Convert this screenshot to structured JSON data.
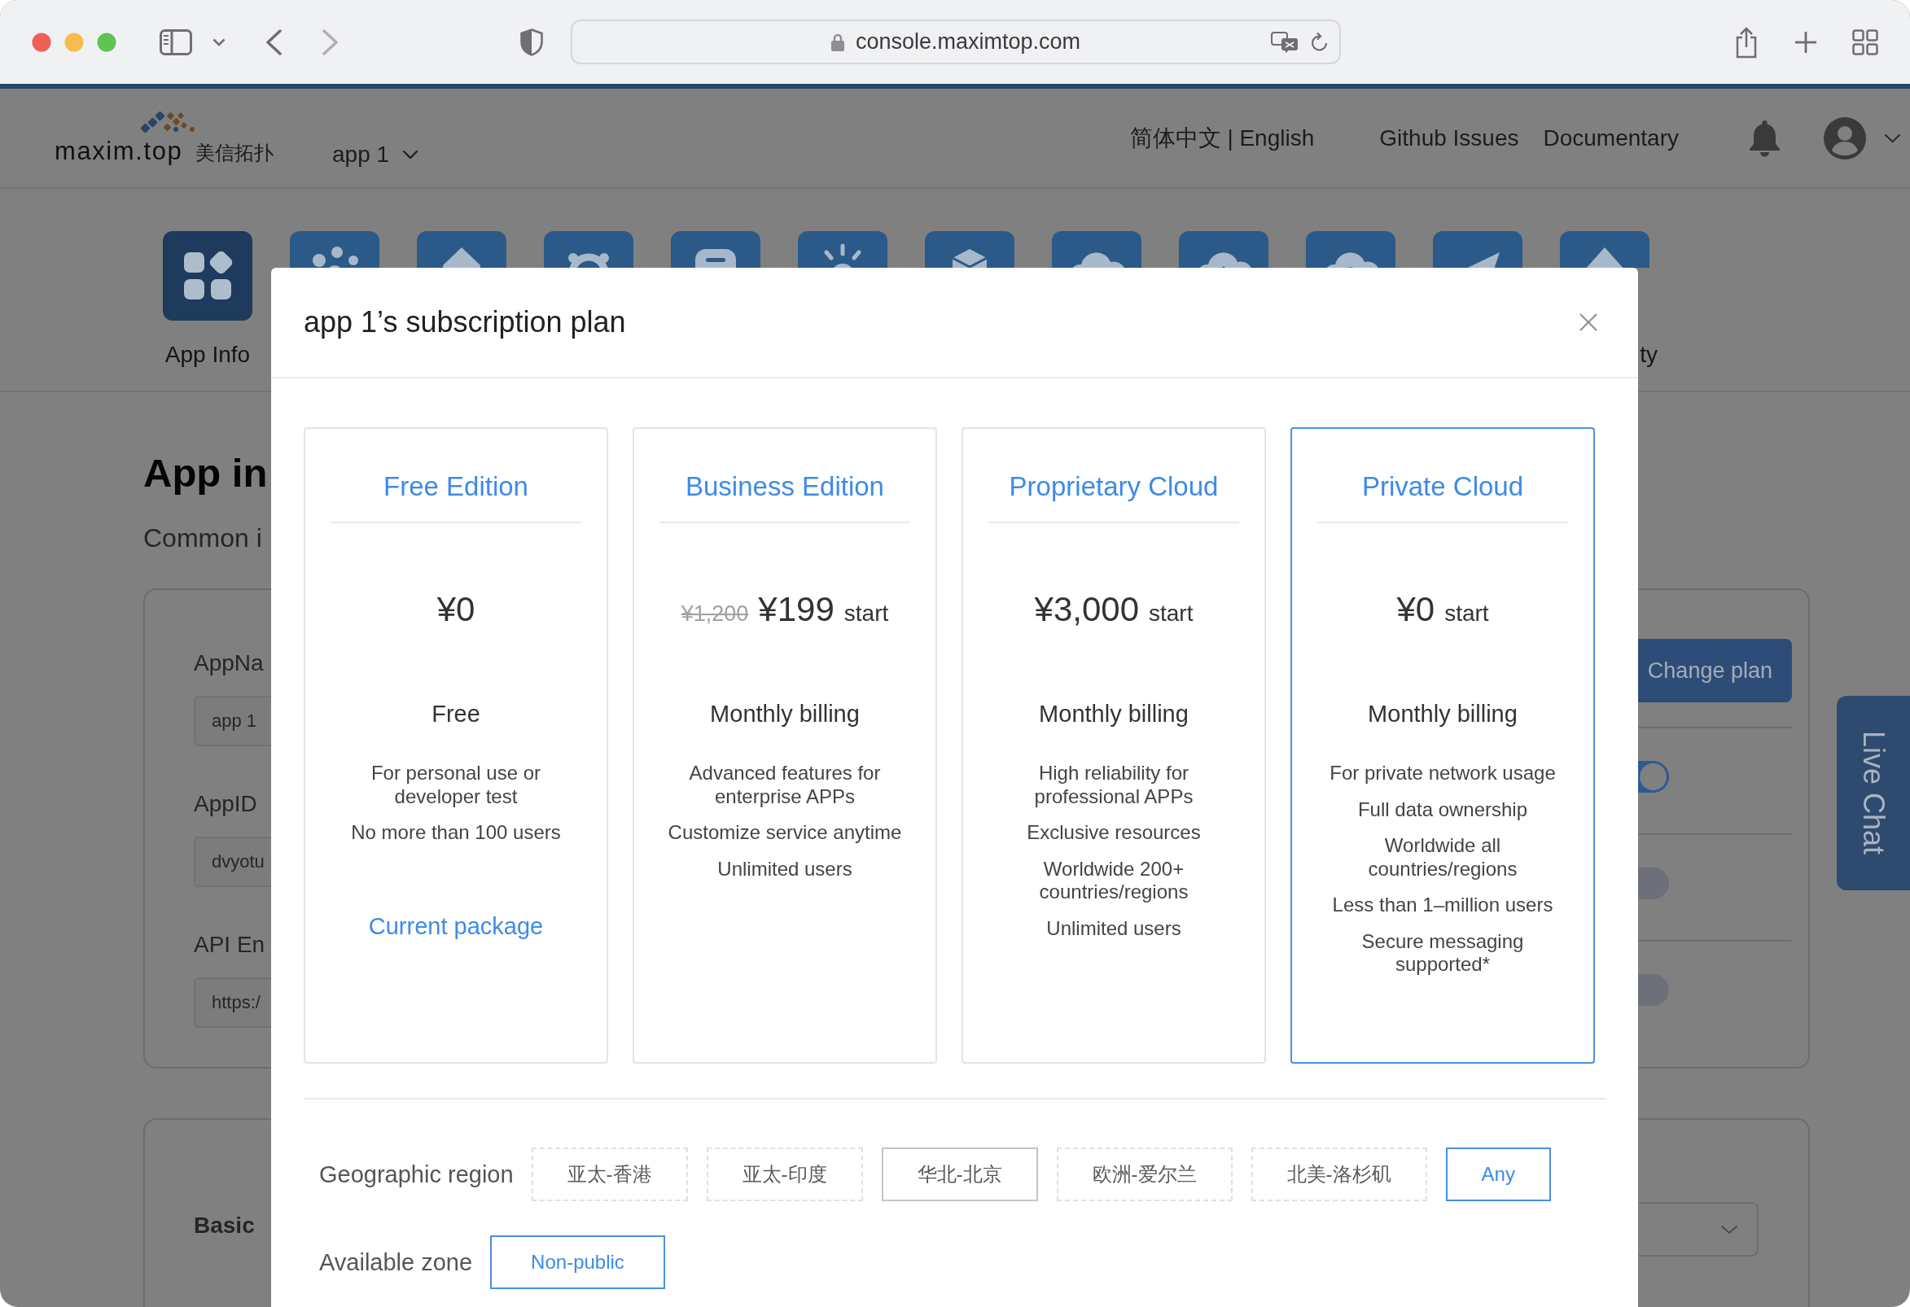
{
  "browser": {
    "url": "console.maximtop.com"
  },
  "header": {
    "logo_text": "maxim.top",
    "logo_subtitle": "美信拓扑",
    "app_selector": "app 1",
    "language": "简体中文 | English",
    "links": [
      "Github Issues",
      "Documentary"
    ]
  },
  "modules": [
    {
      "label": "App Info",
      "selected": true
    },
    {
      "selected": false
    },
    {
      "selected": false
    },
    {
      "selected": false
    },
    {
      "selected": false
    },
    {
      "selected": false
    },
    {
      "selected": false
    },
    {
      "selected": false
    },
    {
      "selected": false
    },
    {
      "selected": false
    },
    {
      "selected": false
    },
    {
      "label": "ty",
      "selected": false
    }
  ],
  "page": {
    "title": "App in",
    "subtitle": "Common i",
    "fields": [
      {
        "label": "AppNa",
        "value": "app 1"
      },
      {
        "label": "AppID",
        "value": "dvyotu"
      },
      {
        "label": "API En",
        "value": "https:/"
      }
    ],
    "change_plan_button": "Change plan",
    "toggles": [
      {
        "on": true
      },
      {
        "on": false
      },
      {
        "on": false
      }
    ],
    "section_title": "Basic"
  },
  "live_chat": "Live Chat",
  "modal": {
    "title": "app 1’s subscription plan",
    "plans": [
      {
        "name": "Free Edition",
        "price": "¥0",
        "billing": "Free",
        "features": [
          "For personal use or developer test",
          "No more than 100 users"
        ],
        "action": "Current package",
        "selected": false
      },
      {
        "name": "Business Edition",
        "original_price": "¥1,200",
        "price": "¥199",
        "price_suffix": "start",
        "billing": "Monthly billing",
        "features": [
          "Advanced features for enterprise APPs",
          "Customize service anytime",
          "Unlimited users"
        ],
        "selected": false
      },
      {
        "name": "Proprietary Cloud",
        "price": "¥3,000",
        "price_suffix": "start",
        "billing": "Monthly billing",
        "features": [
          "High reliability for professional APPs",
          "Exclusive resources",
          "Worldwide 200+ countries/regions",
          "Unlimited users"
        ],
        "selected": false
      },
      {
        "name": "Private Cloud",
        "price": "¥0",
        "price_suffix": "start",
        "billing": "Monthly billing",
        "features": [
          "For private network usage",
          "Full data ownership",
          "Worldwide all countries/regions",
          "Less than 1–million users",
          "Secure messaging supported*"
        ],
        "selected": true
      }
    ],
    "region": {
      "label": "Geographic region",
      "options": [
        {
          "label": "亚太-香港",
          "disabled": true,
          "selected": false
        },
        {
          "label": "亚太-印度",
          "disabled": true,
          "selected": false
        },
        {
          "label": "华北-北京",
          "disabled": false,
          "selected": false
        },
        {
          "label": "欧洲-爱尔兰",
          "disabled": true,
          "selected": false
        },
        {
          "label": "北美-洛杉矶",
          "disabled": true,
          "selected": false
        },
        {
          "label": "Any",
          "disabled": false,
          "selected": true
        }
      ]
    },
    "zone": {
      "label": "Available zone",
      "options": [
        {
          "label": "Non-public",
          "disabled": false,
          "selected": true
        }
      ]
    }
  }
}
